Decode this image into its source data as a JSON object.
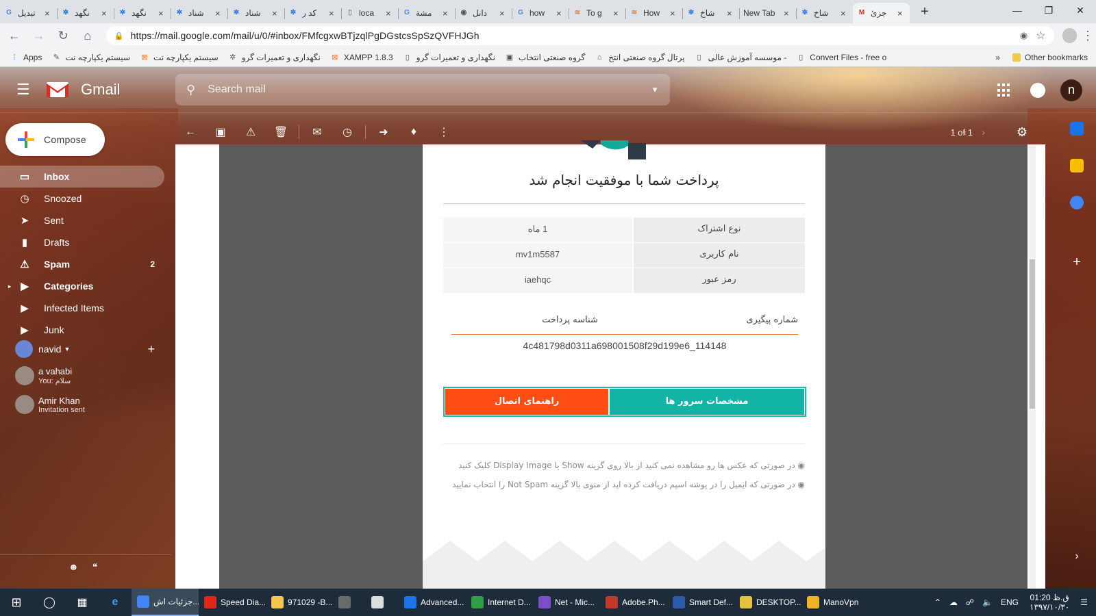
{
  "browser": {
    "tabs": [
      {
        "title": "تبدیل",
        "favicon": "google-icon",
        "color": "#4285f4"
      },
      {
        "title": "نگهد",
        "favicon": "gear-favicon-icon",
        "color": "#1a73e8"
      },
      {
        "title": "نگهد",
        "favicon": "gear-favicon-icon",
        "color": "#1a73e8"
      },
      {
        "title": "شناد",
        "favicon": "gear-favicon-icon",
        "color": "#1a73e8"
      },
      {
        "title": "شناد",
        "favicon": "gear-favicon-icon",
        "color": "#1a73e8"
      },
      {
        "title": "کد ر",
        "favicon": "gear-favicon-icon",
        "color": "#1a73e8"
      },
      {
        "title": "loca",
        "favicon": "page-icon",
        "color": "#888888"
      },
      {
        "title": "مشة",
        "favicon": "google-icon",
        "color": "#4285f4"
      },
      {
        "title": "دانل",
        "favicon": "chat-icon",
        "color": "#555555"
      },
      {
        "title": "how",
        "favicon": "google-icon",
        "color": "#4285f4"
      },
      {
        "title": "To g",
        "favicon": "stack-icon",
        "color": "#f48024"
      },
      {
        "title": "How",
        "favicon": "stack-icon",
        "color": "#f48024"
      },
      {
        "title": "شاخ",
        "favicon": "gear-favicon-icon",
        "color": "#1a73e8"
      },
      {
        "title": "New Tab",
        "favicon": "none",
        "color": "#dee1e6"
      },
      {
        "title": "شاخ",
        "favicon": "gear-favicon-icon",
        "color": "#1a73e8"
      },
      {
        "title": "جزئ",
        "favicon": "gmail-icon",
        "color": "#d93025",
        "active": true
      }
    ],
    "new_tab": "+",
    "url": "https://mail.google.com/mail/u/0/#inbox/FMfcgxwBTjzqlPgDGstcsSpSzQVFHJGh",
    "bookmarks": [
      {
        "label": "Apps",
        "icon": "apps-grid-icon"
      },
      {
        "label": "سیستم یکپارچه نت",
        "icon": "tools-icon"
      },
      {
        "label": "سیستم یکپارچه نت",
        "icon": "xampp-icon"
      },
      {
        "label": "نگهداری و تعمیرات گرو",
        "icon": "gear-favicon-icon"
      },
      {
        "label": "XAMPP 1.8.3",
        "icon": "xampp-icon"
      },
      {
        "label": "نگهداری و تعمیرات گرو",
        "icon": "page-icon"
      },
      {
        "label": "گروه صنعتی انتخاب",
        "icon": "entekhab-icon"
      },
      {
        "label": "پرتال گروه صنعتی انتخ",
        "icon": "portal-icon"
      },
      {
        "label": "موسسه آموزش عالی -",
        "icon": "page-icon"
      },
      {
        "label": "Convert Files - free o",
        "icon": "page-icon"
      }
    ],
    "bookmarks_more": "»",
    "other_bookmarks": "Other bookmarks"
  },
  "gmail": {
    "app_name": "Gmail",
    "search_placeholder": "Search mail",
    "user_initial": "n",
    "compose_label": "Compose",
    "nav": [
      {
        "label": "Inbox",
        "icon": "inbox-icon",
        "selected": true,
        "count": ""
      },
      {
        "label": "Snoozed",
        "icon": "clock-icon",
        "count": ""
      },
      {
        "label": "Sent",
        "icon": "send-icon",
        "count": ""
      },
      {
        "label": "Drafts",
        "icon": "draft-icon",
        "count": ""
      },
      {
        "label": "Spam",
        "icon": "spam-icon",
        "count": "2",
        "bold": true
      },
      {
        "label": "Categories",
        "icon": "label-icon",
        "count": "",
        "bold": true,
        "expandable": true
      },
      {
        "label": "Infected Items",
        "icon": "label-icon",
        "count": ""
      },
      {
        "label": "Junk",
        "icon": "label-icon",
        "count": ""
      }
    ],
    "hangouts_user": "navid",
    "contacts": [
      {
        "name": "a vahabi",
        "status": "You: سلام"
      },
      {
        "name": "Amir Khan",
        "status": "Invitation sent"
      }
    ],
    "pager": "1 of 1"
  },
  "email": {
    "title": "پرداخت شما با موفقیت انجام شد",
    "rows": [
      {
        "key": "نوع اشتراک",
        "value": "1 ماه"
      },
      {
        "key": "نام کاربری",
        "value": "mv1m5587"
      },
      {
        "key": "رمز عبور",
        "value": "iaehqc"
      }
    ],
    "tracking_label": "شماره پیگیری",
    "payment_id_label": "شناسه پرداخت",
    "transaction_id": "4c481798d0311a698001508f29d199e6_114148",
    "btn_servers": "مشخصات سرور ها",
    "btn_guide": "راهنمای اتصال",
    "note1": "در صورتی که عکس ها رو مشاهده نمی کنید از بالا روی گزینه Show یا Display Image کلیک کنید",
    "note2": "در صورتی که ایمیل را در پوشه اسپم دریافت کرده اید از منوی بالا گزینه Not Spam را انتخاب نمایید",
    "colors": {
      "teal": "#12b5a5",
      "orange": "#ff4d13"
    }
  },
  "taskbar": {
    "apps": [
      {
        "label": "جزئیات اش...",
        "color": "#4285f4",
        "active": true
      },
      {
        "label": "Speed Dia...",
        "color": "#e0261b"
      },
      {
        "label": "971029 -B...",
        "color": "#f2c94c"
      },
      {
        "label": "",
        "color": "#6a6a6a"
      },
      {
        "label": "",
        "color": "#dddddd"
      },
      {
        "label": "Advanced...",
        "color": "#1a73e8"
      },
      {
        "label": "Internet D...",
        "color": "#2f9e44"
      },
      {
        "label": "Net - Mic...",
        "color": "#7b4fc9"
      },
      {
        "label": "Adobe.Ph...",
        "color": "#c0392b"
      },
      {
        "label": "Smart Def...",
        "color": "#2a5caa"
      },
      {
        "label": "DESKTOP...",
        "color": "#e5c23e"
      },
      {
        "label": "ManoVpn",
        "color": "#f0b429"
      }
    ],
    "lang": "ENG",
    "time": "01:20 ق.ظ",
    "date": "۱۳۹۷/۱۰/۳۰"
  }
}
